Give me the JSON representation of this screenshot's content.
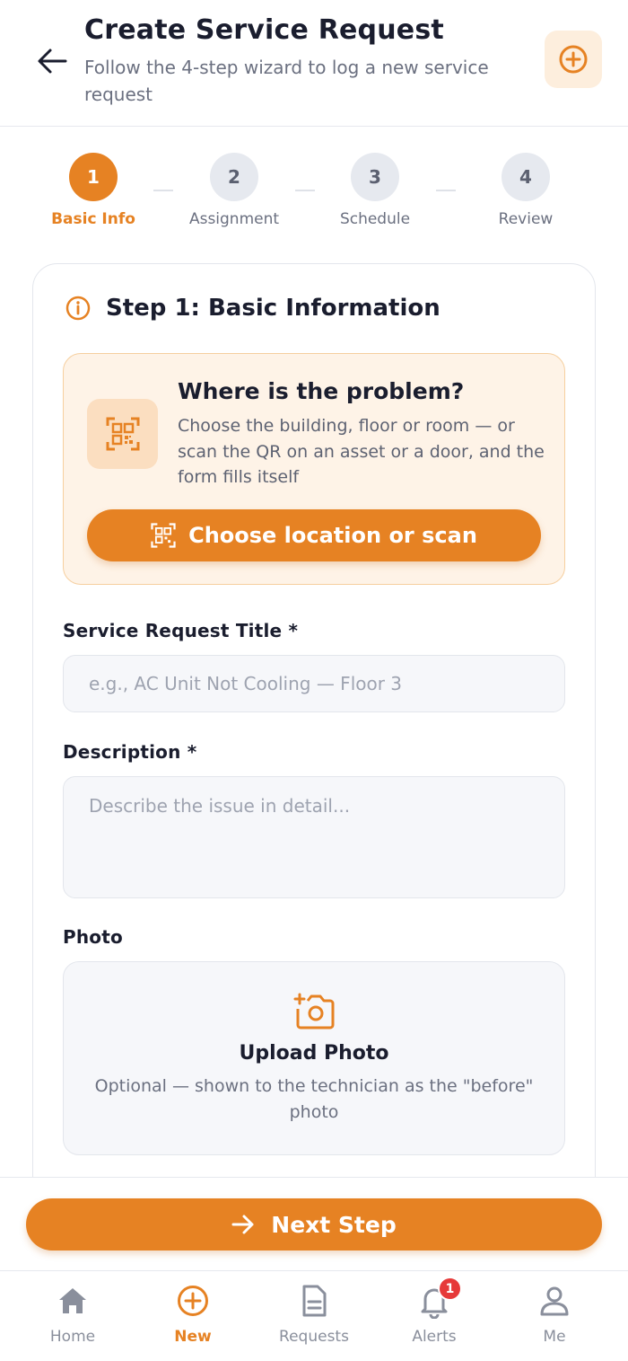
{
  "header": {
    "title": "Create Service Request",
    "subtitle": "Follow the 4-step wizard to log a new service request"
  },
  "stepper": {
    "steps": [
      {
        "number": "1",
        "label": "Basic Info"
      },
      {
        "number": "2",
        "label": "Assignment"
      },
      {
        "number": "3",
        "label": "Schedule"
      },
      {
        "number": "4",
        "label": "Review"
      }
    ],
    "active_step": 1
  },
  "form": {
    "section_title": "Step 1: Basic Information",
    "location": {
      "title": "Where is the problem?",
      "description": "Choose the building, floor or room — or scan the QR on an asset or a door, and the form fills itself",
      "button_label": "Choose location or scan"
    },
    "title_field": {
      "label": "Service Request Title *",
      "value": "",
      "placeholder": "e.g., AC Unit Not Cooling — Floor 3"
    },
    "description_field": {
      "label": "Description *",
      "value": "",
      "placeholder": "Describe the issue in detail..."
    },
    "photo": {
      "label": "Photo",
      "upload_title": "Upload Photo",
      "upload_description": "Optional — shown to the technician as the \"before\" photo"
    }
  },
  "actions": {
    "next_label": "Next Step"
  },
  "tabbar": {
    "items": [
      {
        "label": "Home",
        "icon": "home-icon"
      },
      {
        "label": "New",
        "icon": "plus-circle-icon"
      },
      {
        "label": "Requests",
        "icon": "document-icon"
      },
      {
        "label": "Alerts",
        "icon": "bell-icon"
      },
      {
        "label": "Me",
        "icon": "user-icon"
      }
    ],
    "active": "New",
    "alerts_badge": "1"
  },
  "colors": {
    "accent": "#e68223",
    "badge": "#e63939",
    "text": "#1a1d2e",
    "muted": "#6b7080"
  }
}
